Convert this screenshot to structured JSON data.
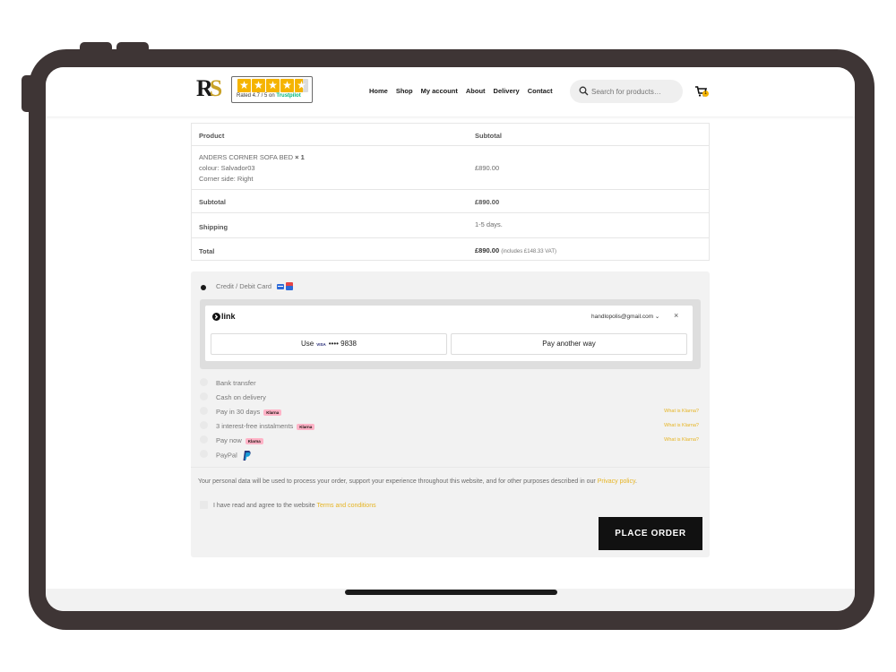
{
  "header": {
    "logo_r": "R",
    "logo_s": "S",
    "trustpilot_text": "Rated 4.7 / 5 on ",
    "trustpilot_brand": "Trustpilot",
    "nav": [
      "Home",
      "Shop",
      "My account",
      "About",
      "Delivery",
      "Contact"
    ],
    "search_placeholder": "Search for products…",
    "cart_count": "1"
  },
  "order": {
    "col_product": "Product",
    "col_subtotal": "Subtotal",
    "item_name": "ANDERS CORNER SOFA BED",
    "item_qty": "× 1",
    "item_colour": "colour: Salvador03",
    "item_side": "Corner side: Right",
    "item_price": "£890.00",
    "subtotal_label": "Subtotal",
    "subtotal_value": "£890.00",
    "shipping_label": "Shipping",
    "shipping_value": "1-5 days.",
    "total_label": "Total",
    "total_value": "£890.00",
    "total_vat": "(includes £148.33 VAT)"
  },
  "payment": {
    "card_label": "Credit / Debit Card",
    "link_brand": "link",
    "link_email": "handlopolis@gmail.com",
    "use_label": "Use",
    "visa": "VISA",
    "card_masked": "•••• 9838",
    "pay_another": "Pay another way",
    "methods": [
      {
        "label": "Bank transfer",
        "klarna": false
      },
      {
        "label": "Cash on delivery",
        "klarna": false
      },
      {
        "label": "Pay in 30 days",
        "klarna": true
      },
      {
        "label": "3 interest-free instalments",
        "klarna": true
      },
      {
        "label": "Pay now",
        "klarna": true
      },
      {
        "label": "PayPal",
        "klarna": false
      }
    ],
    "klarna_badge": "Klarna",
    "what_is_klarna": "What is Klarna?",
    "privacy_text": "Your personal data will be used to process your order, support your experience throughout this website, and for other purposes described in our ",
    "privacy_link": "Privacy policy",
    "privacy_end": ".",
    "terms_text": "I have read and agree to the website ",
    "terms_link": "Terms and conditions",
    "place_order": "PLACE ORDER"
  },
  "colors": {
    "frame": "#3e3535",
    "accent": "#e6b422",
    "trustpilot_star": "#f5b400",
    "button": "#111111"
  }
}
